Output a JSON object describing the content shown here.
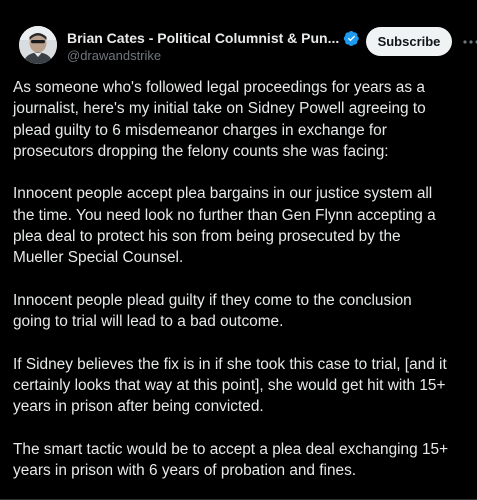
{
  "author": {
    "display_name": "Brian Cates - Political Columnist & Pun...",
    "handle": "@drawandstrike",
    "verified": true,
    "verified_color": "#1d9bf0"
  },
  "actions": {
    "subscribe_label": "Subscribe",
    "more_icon": "more-horizontal-icon"
  },
  "tweet": {
    "paragraphs": [
      "As someone who's followed legal proceedings for years as a\njournalist, here's my initial take on Sidney Powell agreeing to\nplead guilty to 6 misdemeanor charges in exchange for\nprosecutors dropping the felony counts she was facing:",
      "Innocent people accept plea bargains in our justice system all\nthe time. You need look no further than Gen Flynn accepting a\nplea deal to protect his son from being prosecuted by the\nMueller Special Counsel.",
      "Innocent people plead guilty if they come to the conclusion\ngoing to trial will lead to a bad outcome.",
      "If Sidney believes the fix is in if she took this case to trial, [and it\ncertainly looks that way at this point], she would get hit with 15+\nyears in prison after being convicted.",
      "The smart tactic would be to accept a plea deal exchanging 15+\nyears in prison with 6 years of probation and fines."
    ]
  },
  "colors": {
    "background": "#000000",
    "text_primary": "#e7e9ea",
    "text_secondary": "#71767b",
    "button_bg": "#eff3f4",
    "button_text": "#0f1419"
  }
}
